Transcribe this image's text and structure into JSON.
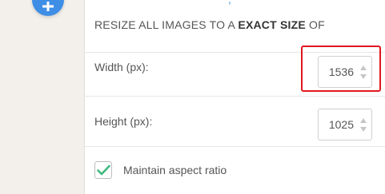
{
  "header": {
    "text_prefix": "RESIZE ALL IMAGES TO A ",
    "text_bold": "EXACT SIZE",
    "text_suffix": " OF"
  },
  "width": {
    "label": "Width (px):",
    "value": "1536"
  },
  "height": {
    "label": "Height (px):",
    "value": "1025"
  },
  "aspect": {
    "label": "Maintain aspect ratio",
    "checked": true
  },
  "colors": {
    "accent": "#3f8ee6",
    "check": "#3fb97f",
    "highlight": "#e0181f",
    "rail": "#f3f0eb"
  },
  "icons": [
    "add-icon",
    "spin-up-icon",
    "spin-down-icon",
    "checkmark-icon"
  ]
}
